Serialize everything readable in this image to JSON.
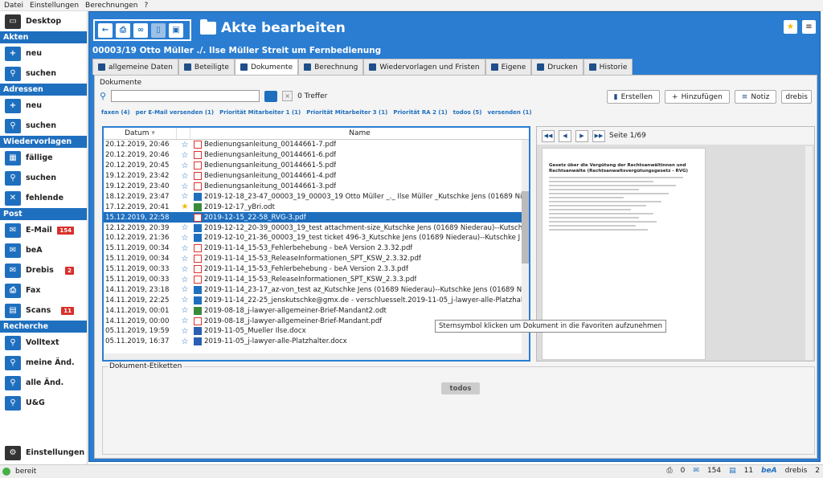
{
  "menu": [
    "Datei",
    "Einstellungen",
    "Berechnungen",
    "?"
  ],
  "sidebar": {
    "desktop": "Desktop",
    "sections": [
      {
        "title": "Akten",
        "items": [
          {
            "label": "neu",
            "icon": "folder-plus-icon"
          },
          {
            "label": "suchen",
            "icon": "search-icon"
          }
        ]
      },
      {
        "title": "Adressen",
        "items": [
          {
            "label": "neu",
            "icon": "person-plus-icon"
          },
          {
            "label": "suchen",
            "icon": "search-icon"
          }
        ]
      },
      {
        "title": "Wiedervorlagen",
        "items": [
          {
            "label": "fällige",
            "icon": "calendar-icon"
          },
          {
            "label": "suchen",
            "icon": "search-icon"
          },
          {
            "label": "fehlende",
            "icon": "calendar-x-icon"
          }
        ]
      },
      {
        "title": "Post",
        "items": [
          {
            "label": "E-Mail",
            "icon": "mail-icon",
            "badge": "154"
          },
          {
            "label": "beA",
            "icon": "bea-icon"
          },
          {
            "label": "Drebis",
            "icon": "drebis-icon",
            "badge": "2"
          },
          {
            "label": "Fax",
            "icon": "printer-icon"
          },
          {
            "label": "Scans",
            "icon": "scan-icon",
            "badge": "11"
          }
        ]
      },
      {
        "title": "Recherche",
        "items": [
          {
            "label": "Volltext",
            "icon": "search-icon"
          },
          {
            "label": "meine Änd.",
            "icon": "person-search-icon"
          },
          {
            "label": "alle Änd.",
            "icon": "people-search-icon"
          },
          {
            "label": "U&G",
            "icon": "search-icon"
          }
        ]
      }
    ],
    "settings": "Einstellungen"
  },
  "header": {
    "title": "Akte bearbeiten",
    "subtitle": "00003/19 Otto Müller ./. Ilse Müller Streit um Fernbedienung"
  },
  "tabs": [
    "allgemeine Daten",
    "Beteiligte",
    "Dokumente",
    "Berechnung",
    "Wiedervorlagen und Fristen",
    "Eigene",
    "Drucken",
    "Historie"
  ],
  "active_tab": 2,
  "docs": {
    "label": "Dokumente",
    "hits": "0 Treffer",
    "buttons": {
      "create": "Erstellen",
      "add": "Hinzufügen",
      "note": "Notiz",
      "drebis": "drebis"
    },
    "filters": [
      "faxen (4)",
      "per E-Mail versenden (1)",
      "Priorität Mitarbeiter 1 (1)",
      "Priorität Mitarbeiter 3 (1)",
      "Priorität RA 2 (1)",
      "todos (5)",
      "versenden (1)"
    ],
    "col_date": "Datum",
    "col_name": "Name",
    "rows": [
      {
        "date": "20.12.2019, 20:46",
        "name": "Bedienungsanleitung_00144661-7.pdf",
        "type": "pdf"
      },
      {
        "date": "20.12.2019, 20:46",
        "name": "Bedienungsanleitung_00144661-6.pdf",
        "type": "pdf"
      },
      {
        "date": "20.12.2019, 20:45",
        "name": "Bedienungsanleitung_00144661-5.pdf",
        "type": "pdf"
      },
      {
        "date": "19.12.2019, 23:42",
        "name": "Bedienungsanleitung_00144661-4.pdf",
        "type": "pdf"
      },
      {
        "date": "19.12.2019, 23:40",
        "name": "Bedienungsanleitung_00144661-3.pdf",
        "type": "pdf"
      },
      {
        "date": "18.12.2019, 23:47",
        "name": "2019-12-18_23-47_00003_19_00003_19 Otto Müller _._ Ilse Müller _Kutschke  Jens (01689 Nie",
        "type": "mail"
      },
      {
        "date": "17.12.2019, 20:41",
        "name": "2019-12-17_yBri.odt",
        "type": "odt",
        "fav": true
      },
      {
        "date": "15.12.2019, 22:58",
        "name": "2019-12-15_22-58_RVG-3.pdf",
        "type": "pdf",
        "selected": true
      },
      {
        "date": "12.12.2019, 20:39",
        "name": "2019-12-12_20-39_00003_19_test attachment-size_Kutschke  Jens (01689 Niederau)--Kutsch",
        "type": "mail"
      },
      {
        "date": "10.12.2019, 21:36",
        "name": "2019-12-10_21-36_00003_19_test ticket 496-3_Kutschke  Jens (01689 Niederau)--Kutschke  J",
        "type": "mail"
      },
      {
        "date": "15.11.2019, 00:34",
        "name": "2019-11-14_15-53_Fehlerbehebung - beA Version 2.3.32.pdf",
        "type": "pdf"
      },
      {
        "date": "15.11.2019, 00:34",
        "name": "2019-11-14_15-53_ReleaseInformationen_SPT_KSW_2.3.32.pdf",
        "type": "pdf"
      },
      {
        "date": "15.11.2019, 00:33",
        "name": "2019-11-14_15-53_Fehlerbehebung - beA Version 2.3.3.pdf",
        "type": "pdf"
      },
      {
        "date": "15.11.2019, 00:33",
        "name": "2019-11-14_15-53_ReleaseInformationen_SPT_KSW_2.3.3.pdf",
        "type": "pdf"
      },
      {
        "date": "14.11.2019, 23:18",
        "name": "2019-11-14_23-17_az-von_test az_Kutschke  Jens (01689 Niederau)--Kutschke  Jens (01689 N",
        "type": "mail"
      },
      {
        "date": "14.11.2019, 22:25",
        "name": "2019-11-14_22-25_jenskutschke@gmx.de - verschluesselt.2019-11-05_j-lawyer-alle-Platzhalt",
        "type": "mail"
      },
      {
        "date": "14.11.2019, 00:01",
        "name": "2019-08-18_j-lawyer-allgemeiner-Brief-Mandant2.odt",
        "type": "odt"
      },
      {
        "date": "14.11.2019, 00:00",
        "name": "2019-08-18_j-lawyer-allgemeiner-Brief-Mandant.pdf",
        "type": "pdf"
      },
      {
        "date": "05.11.2019, 19:59",
        "name": "2019-11-05_Mueller Ilse.docx",
        "type": "doc"
      },
      {
        "date": "05.11.2019, 16:37",
        "name": "2019-11-05_j-lawyer-alle-Platzhalter.docx",
        "type": "doc"
      }
    ]
  },
  "preview": {
    "page": "Seite 1/69",
    "doc_title": "Gesetz über die Vergütung der Rechtsanwältinnen und Rechtsanwälte (Rechtsanwaltsvergütungsgesetz - RVG)"
  },
  "tooltip": "Sternsymbol klicken um Dokument in die Favoriten aufzunehmen",
  "etiketten": {
    "label": "Dokument-Etiketten",
    "chip": "todos"
  },
  "status": {
    "text": "bereit",
    "count_print": "0",
    "count_mail": "154",
    "count_scan": "11",
    "bea": "beA",
    "drebis": "drebis",
    "drebis_count": "2"
  }
}
